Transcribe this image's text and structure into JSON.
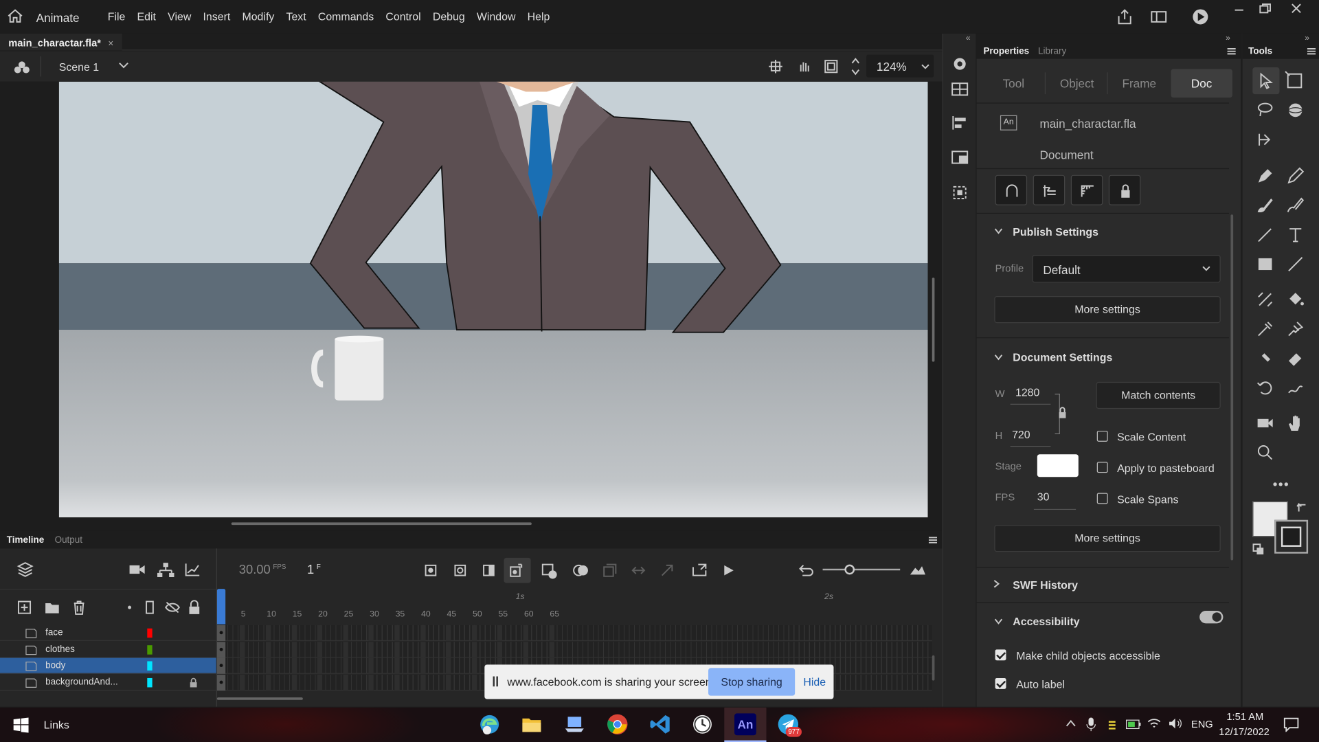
{
  "app": {
    "name": "Animate",
    "menu": [
      "File",
      "Edit",
      "View",
      "Insert",
      "Modify",
      "Text",
      "Commands",
      "Control",
      "Debug",
      "Window",
      "Help"
    ]
  },
  "doc_tab": {
    "name": "main_charactar.fla*"
  },
  "editbar": {
    "scene": "Scene 1",
    "zoom": "124%"
  },
  "properties": {
    "tabs": [
      "Properties",
      "Library"
    ],
    "subtabs": [
      "Tool",
      "Object",
      "Frame",
      "Doc"
    ],
    "active_subtab": "Doc",
    "doc_badge": "An",
    "file": "main_charactar.fla",
    "doc_label": "Document",
    "publish": {
      "title": "Publish Settings",
      "profile_label": "Profile",
      "profile_value": "Default",
      "more": "More settings"
    },
    "docset": {
      "title": "Document Settings",
      "w_label": "W",
      "w": "1280",
      "h_label": "H",
      "h": "720",
      "match": "Match contents",
      "scale_content": "Scale Content",
      "stage_label": "Stage",
      "stage_color": "#ffffff",
      "apply": "Apply to pasteboard",
      "fps_label": "FPS",
      "fps": "30",
      "scale_spans": "Scale Spans",
      "more": "More settings"
    },
    "swf": "SWF History",
    "access": {
      "title": "Accessibility",
      "make_child": "Make child objects accessible",
      "auto_label": "Auto label"
    }
  },
  "tools": {
    "title": "Tools"
  },
  "timeline": {
    "tabs": [
      "Timeline",
      "Output"
    ],
    "fps": "30.00",
    "fps_unit": "FPS",
    "frame": "1",
    "frame_unit": "F",
    "ruler": [
      "5",
      "10",
      "15",
      "20",
      "25",
      "30",
      "35",
      "40",
      "45",
      "50",
      "55",
      "60",
      "65"
    ],
    "secs": [
      "1s",
      "2s"
    ],
    "layers": [
      {
        "name": "face",
        "color": "#ff0000",
        "selected": false,
        "locked": false
      },
      {
        "name": "clothes",
        "color": "#4a9a00",
        "selected": false,
        "locked": false
      },
      {
        "name": "body",
        "color": "#00e5ff",
        "selected": true,
        "locked": false
      },
      {
        "name": "backgroundAnd...",
        "color": "#00e5ff",
        "selected": false,
        "locked": true
      }
    ]
  },
  "share_bar": {
    "text": "www.facebook.com is sharing your screen.",
    "stop": "Stop sharing",
    "hide": "Hide"
  },
  "taskbar": {
    "links": "Links",
    "lang": "ENG",
    "time": "1:51 AM",
    "date": "12/17/2022",
    "telegram_badge": "977"
  }
}
